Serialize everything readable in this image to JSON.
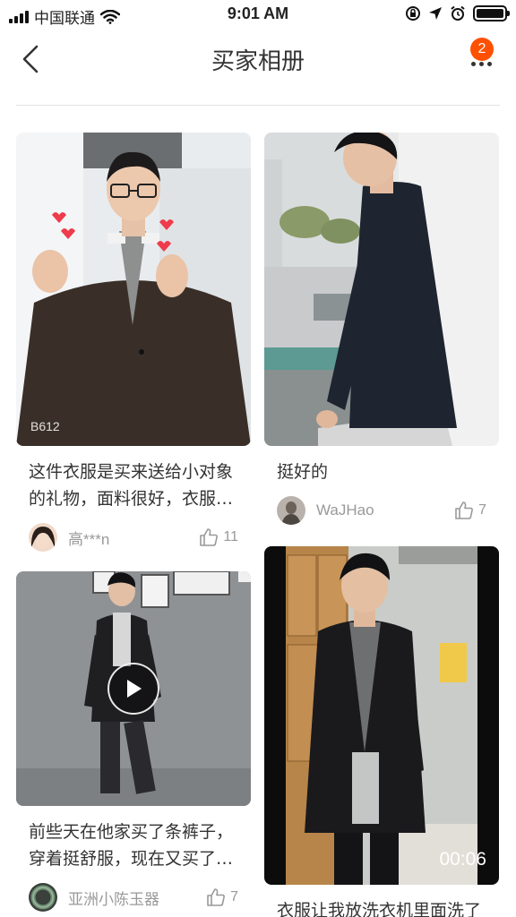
{
  "status_bar": {
    "carrier": "中国联通",
    "time": "9:01 AM"
  },
  "nav": {
    "title": "买家相册",
    "badge_count": "2"
  },
  "posts": [
    {
      "caption": "这件衣服是买来送给小对象的礼物，面料很好，衣服…",
      "user": "高***n",
      "likes": "11",
      "image_watermark": "B612"
    },
    {
      "caption": "挺好的",
      "user": "WaJHao",
      "likes": "7"
    },
    {
      "caption": "前些天在他家买了条裤子，穿着挺舒服，现在又买了…",
      "user": "亚洲小陈玉器",
      "likes": "7",
      "is_video": true
    },
    {
      "caption": "衣服让我放洗衣机里面洗了",
      "duration": "00:06",
      "is_video": true
    }
  ],
  "colors": {
    "accent": "#ff5000",
    "text_primary": "#333333",
    "text_secondary": "#999999"
  }
}
